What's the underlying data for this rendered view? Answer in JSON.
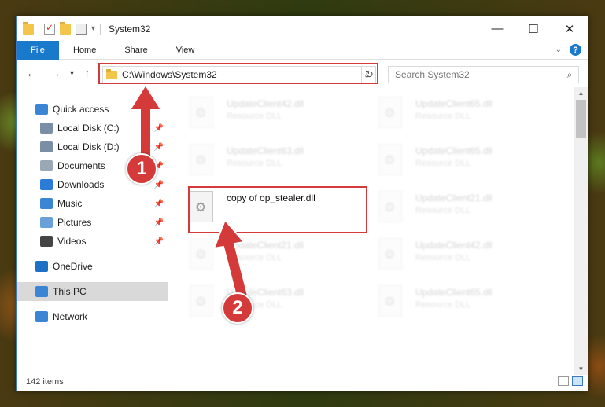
{
  "window": {
    "title": "System32"
  },
  "ribbon": {
    "tabs": [
      "File",
      "Home",
      "Share",
      "View"
    ],
    "help": "?"
  },
  "caption": {
    "minimize": "—",
    "maximize": "☐",
    "close": "✕"
  },
  "nav": {
    "back": "←",
    "forward": "→",
    "recent": "▾",
    "up": "↑",
    "address": "C:\\Windows\\System32",
    "search_placeholder": "Search System32"
  },
  "sidebar": {
    "items": [
      {
        "label": "Quick access",
        "icon": "star-icon",
        "color": "#3a86d4"
      },
      {
        "label": "Local Disk (C:)",
        "icon": "drive-icon",
        "color": "#7a8fa6",
        "pinned": true
      },
      {
        "label": "Local Disk (D:)",
        "icon": "drive-icon",
        "color": "#7a8fa6",
        "pinned": true
      },
      {
        "label": "Documents",
        "icon": "document-icon",
        "color": "#9aa8b6",
        "pinned": true
      },
      {
        "label": "Downloads",
        "icon": "download-icon",
        "color": "#2b7bd8",
        "pinned": true
      },
      {
        "label": "Music",
        "icon": "music-icon",
        "color": "#3a86d4",
        "pinned": true
      },
      {
        "label": "Pictures",
        "icon": "pictures-icon",
        "color": "#6aa0d8",
        "pinned": true
      },
      {
        "label": "Videos",
        "icon": "videos-icon",
        "color": "#444",
        "pinned": true
      },
      {
        "label": "OneDrive",
        "icon": "cloud-icon",
        "color": "#1f6fc4"
      },
      {
        "label": "This PC",
        "icon": "computer-icon",
        "color": "#3a86d4",
        "selected": true
      },
      {
        "label": "Network",
        "icon": "network-icon",
        "color": "#3a86d4"
      }
    ]
  },
  "files": [
    {
      "name": "UpdateClient42.dll",
      "type": "Resource DLL"
    },
    {
      "name": "UpdateClient65.dll",
      "type": "Resource DLL"
    },
    {
      "name": "UpdateClient63.dll",
      "type": "Resource DLL"
    },
    {
      "name": "UpdateClient65.dll",
      "type": "Resource DLL"
    },
    {
      "name": "copy of op_stealer.dll",
      "type": ""
    },
    {
      "name": "UpdateClient21.dll",
      "type": "Resource DLL"
    },
    {
      "name": "UpdateClient21.dll",
      "type": "Resource DLL"
    },
    {
      "name": "UpdateClient42.dll",
      "type": "Resource DLL"
    },
    {
      "name": "UpdateClient63.dll",
      "type": "Resource DLL"
    },
    {
      "name": "UpdateClient65.dll",
      "type": "Resource DLL"
    }
  ],
  "status": {
    "items": "142 items"
  },
  "annotations": {
    "step1": "1",
    "step2": "2",
    "color": "#d43a3a"
  }
}
